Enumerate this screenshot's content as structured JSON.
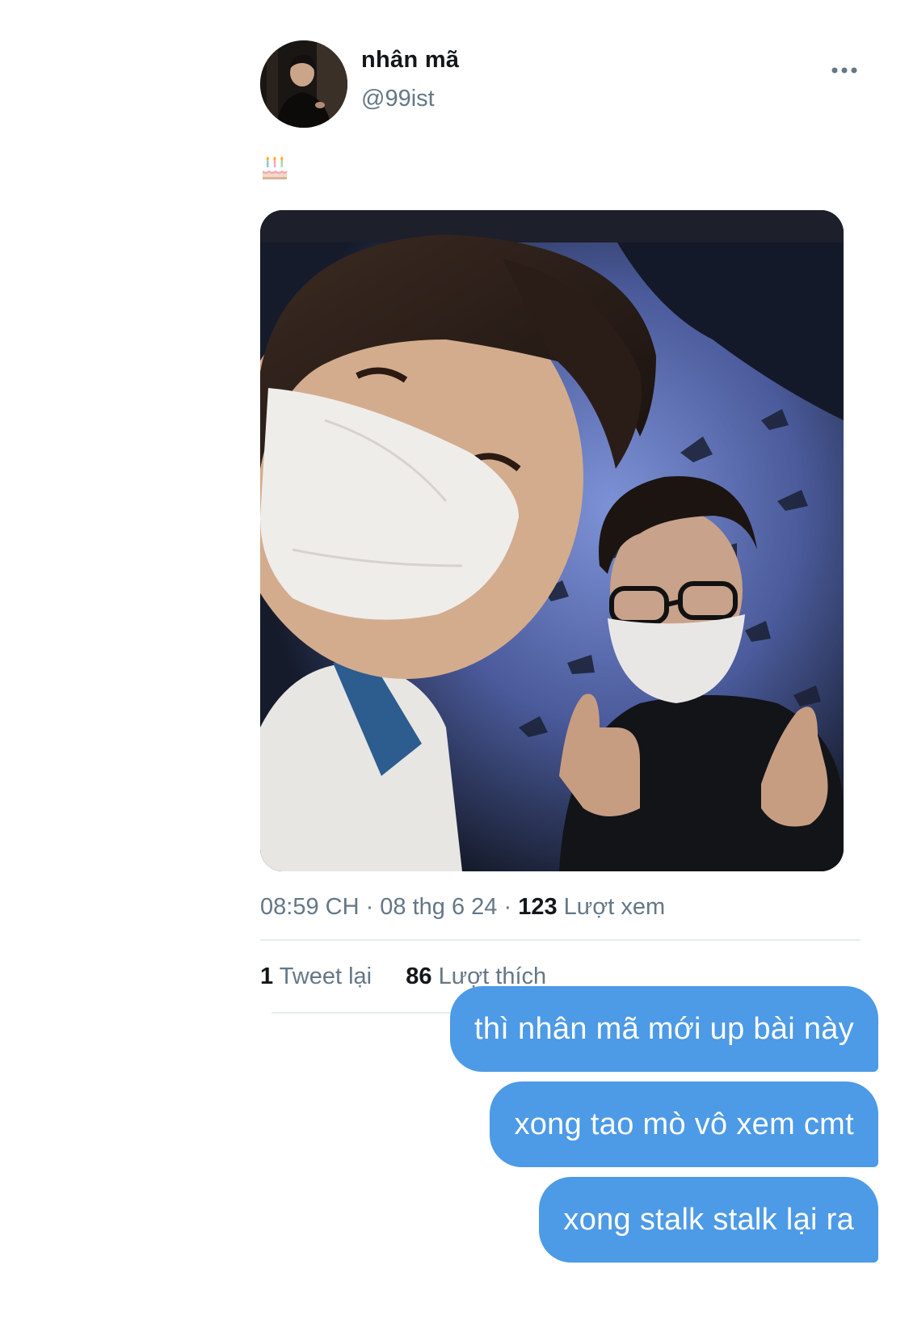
{
  "tweet": {
    "display_name": "nhân mã",
    "handle": "@99ist",
    "text_emoji_icon": "birthday-cake-icon",
    "time": "08:59 CH",
    "date": "08 thg 6 24",
    "views_count": "123",
    "views_label": "Lượt xem",
    "retweets_count": "1",
    "retweets_label": "Tweet lại",
    "likes_count": "86",
    "likes_label": "Lượt thích",
    "more_icon": "more-options-icon"
  },
  "messages": [
    {
      "text": "thì nhân mã mới up bài này"
    },
    {
      "text": "xong tao mò vô xem cmt"
    },
    {
      "text": "xong stalk stalk lại ra"
    }
  ],
  "colors": {
    "bubble": "#4d9ae6",
    "secondary_text": "#657786",
    "primary_text": "#14171a",
    "divider": "#e6ecf0"
  }
}
